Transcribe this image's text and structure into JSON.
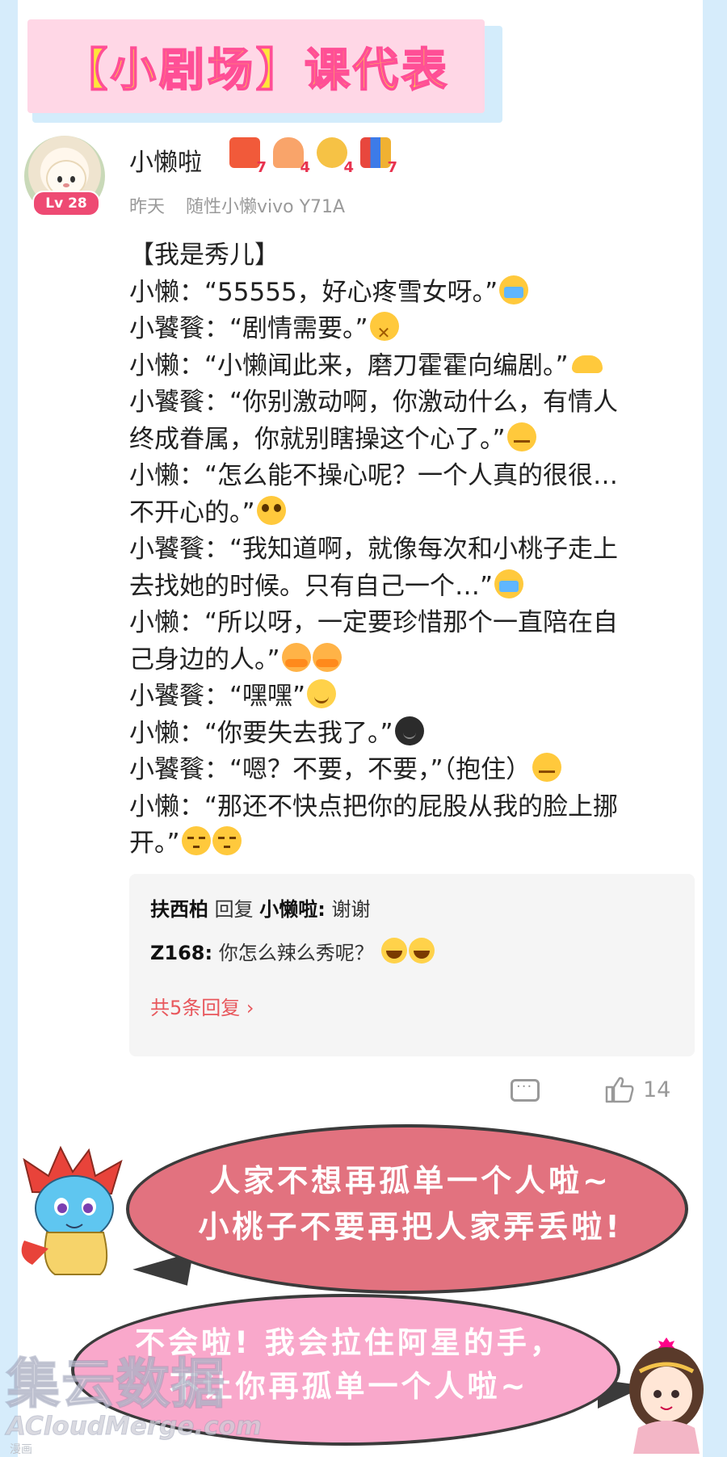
{
  "banner": {
    "title": "【小剧场】课代表"
  },
  "post": {
    "author": "小懒啦",
    "level": "Lv 28",
    "badges": [
      {
        "icon": "gift-icon",
        "count": "7",
        "color": "#f15a3a"
      },
      {
        "icon": "thumbs-up-icon",
        "count": "4",
        "color": "#f9a46a"
      },
      {
        "icon": "medal-icon",
        "count": "4",
        "color": "#f6c245"
      },
      {
        "icon": "books-icon",
        "count": "7",
        "color": "#e8473d"
      }
    ],
    "time": "昨天",
    "device": "随性小懒vivo Y71A",
    "lines": [
      {
        "text": "【我是秀儿】",
        "emoji": []
      },
      {
        "text": "小懒：“55555，好心疼雪女呀。”",
        "emoji": [
          "crying-emoji"
        ]
      },
      {
        "text": "小饕餮：“剧情需要。”",
        "emoji": [
          "zipper-mouth-emoji"
        ]
      },
      {
        "text": "小懒：“小懒闻此来，磨刀霍霍向编剧。”",
        "emoji": [
          "muscle-emoji"
        ]
      },
      {
        "text": "小饕餮：“你别激动啊，你激动什么，有情人",
        "emoji": []
      },
      {
        "text": "终成眷属，你就别瞎操这个心了。”",
        "emoji": [
          "persevere-emoji"
        ]
      },
      {
        "text": "小懒：“怎么能不操心呢？一个人真的很很…",
        "emoji": []
      },
      {
        "text": "不开心的。”",
        "emoji": [
          "pleading-emoji"
        ]
      },
      {
        "text": "小饕餮：“我知道啊，就像每次和小桃子走上",
        "emoji": []
      },
      {
        "text": "去找她的时候。只有自己一个…”",
        "emoji": [
          "crying-emoji"
        ]
      },
      {
        "text": "小懒：“所以呀，一定要珍惜那个一直陪在自",
        "emoji": []
      },
      {
        "text": "己身边的人。”",
        "emoji": [
          "hugging-emoji",
          "hugging-emoji"
        ]
      },
      {
        "text": "小饕餮：“嘿嘿”",
        "emoji": [
          "smiling-emoji"
        ]
      },
      {
        "text": "小懒：“你要失去我了。”",
        "emoji": [
          "dark-face-emoji"
        ]
      },
      {
        "text": "小饕餮：“嗯？不要，不要，”（抱住）",
        "emoji": [
          "smirk-emoji"
        ]
      },
      {
        "text": "小懒：“那还不快点把你的屁股从我的脸上挪",
        "emoji": []
      },
      {
        "text": "开。”",
        "emoji": [
          "unamused-emoji",
          "unamused-emoji"
        ]
      }
    ]
  },
  "replies": {
    "line1": {
      "user": "扶西柏",
      "verb": "回复",
      "target": "小懒啦:",
      "text": "谢谢"
    },
    "line2": {
      "user": "Z168:",
      "text": "你怎么辣么秀呢？"
    },
    "more": "共5条回复 ›"
  },
  "actions": {
    "like_count": "14"
  },
  "bubbles": {
    "pink_top": [
      "人家不想再孤单一个人啦~",
      "小桃子不要再把人家弄丢啦!"
    ],
    "pink_bottom": [
      "不会啦! 我会拉住阿星的手，",
      "不让你再孤单一个人啦~"
    ]
  },
  "watermark": {
    "big": "集云数据",
    "small": "ACloudMerge.com",
    "tiny": "漫画"
  }
}
